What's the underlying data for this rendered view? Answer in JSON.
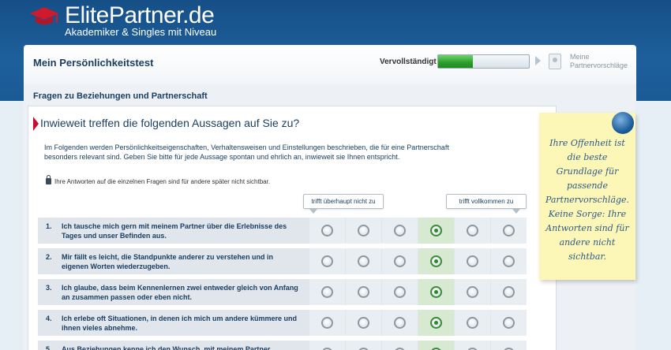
{
  "header": {
    "brand": "ElitePartner",
    "brand_tld": ".de",
    "tagline": "Akademiker & Singles mit Niveau"
  },
  "topbar": {
    "title": "Mein Persönlichkeitstest",
    "progress_label": "Vervollständigt",
    "progress_fraction": 0.38,
    "next_step": "Meine Partnervorschläge"
  },
  "section": {
    "title": "Fragen zu Beziehungen und Partnerschaft"
  },
  "question_block": {
    "heading": "Inwieweit treffen die folgenden Aussagen auf Sie zu?",
    "intro": "Im Folgenden werden Persönlichkeitseigenschaften, Verhaltensweisen und Einstellungen beschrieben, die für eine Partnerschaft besonders relevant sind. Geben Sie bitte für jede Aussage spontan und ehrlich an, inwieweit sie Ihnen entspricht.",
    "privacy": "Ihre Antworten auf die einzelnen Fragen sind für andere später nicht sichtbar.",
    "scale_low": "trifft überhaupt nicht zu",
    "scale_high": "trifft vollkommen zu",
    "options_count": 6,
    "items": [
      {
        "num": "1.",
        "text": "Ich tausche mich gern mit meinem Partner über die Erlebnisse des Tages und unser Befinden aus.",
        "selected": 3
      },
      {
        "num": "2.",
        "text": "Mir fällt es leicht, die Standpunkte anderer zu verstehen und in eigenen Worten wiederzugeben.",
        "selected": 3
      },
      {
        "num": "3.",
        "text": "Ich glaube, dass beim Kennenlernen zwei entweder gleich von Anfang an zusammen passen oder eben nicht.",
        "selected": 3
      },
      {
        "num": "4.",
        "text": "Ich erlebe oft Situationen, in denen ich mich um andere kümmere und ihnen vieles abnehme.",
        "selected": 3
      },
      {
        "num": "5.",
        "text": "Aus Beziehungen kenne ich den Wunsch, mit meinem Partner",
        "selected": 3
      }
    ]
  },
  "sticky_note": {
    "text": "Ihre Offenheit ist die beste Grundlage für passende Partnervorschläge. Keine Sorge: Ihre Antworten sind für andere nicht sichtbar."
  },
  "colors": {
    "header_blue": "#1d5f9c",
    "text_blue": "#1b3f62",
    "progress_green": "#2fa02f",
    "accent_red": "#c8102e",
    "note_yellow": "#fcf7b6"
  }
}
